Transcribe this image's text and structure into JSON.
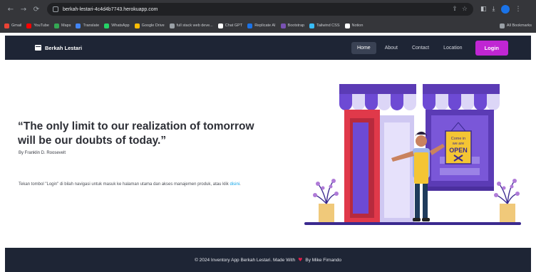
{
  "browser": {
    "url": "berkah-lestari-4c4d4b7743.herokuapp.com",
    "bookmarks": [
      {
        "label": "Gmail",
        "color": "#ea4335"
      },
      {
        "label": "YouTube",
        "color": "#ff0000"
      },
      {
        "label": "Maps",
        "color": "#34a853"
      },
      {
        "label": "Translate",
        "color": "#4285f4"
      },
      {
        "label": "WhatsApp",
        "color": "#25d366"
      },
      {
        "label": "Google Drive",
        "color": "#fbbc04"
      },
      {
        "label": "full stack web deve...",
        "color": "#9aa0a6"
      },
      {
        "label": "Chat GPT",
        "color": "#ffffff"
      },
      {
        "label": "Replicate AI",
        "color": "#1a73e8"
      },
      {
        "label": "Bootstrap",
        "color": "#7952b3"
      },
      {
        "label": "Tailwind CSS",
        "color": "#38bdf8"
      },
      {
        "label": "Notion",
        "color": "#ffffff"
      }
    ],
    "bookmarks_right": "All Bookmarks"
  },
  "navbar": {
    "brand": "Berkah Lestari",
    "links": [
      "Home",
      "About",
      "Contact",
      "Location"
    ],
    "login": "Login"
  },
  "hero": {
    "quote": "“The only limit to our realization of tomorrow will be our doubts of today.”",
    "author": "By Franklin D. Roosevelt",
    "instruction_text": "Tekan tombol \"Login\" di bilah navigasi untuk masuk ke halaman utama dan akses manajemen produk, atau klik ",
    "instruction_link": "disini",
    "instruction_end": ".",
    "sign": {
      "line1": "Come in",
      "line2": "we are",
      "line3": "OPEN"
    }
  },
  "footer": {
    "text_before": "© 2024 Inventory App Berkah Lestari. Made With",
    "text_after": "By Mike Firnando"
  },
  "colors": {
    "navbar": "#1e2535",
    "accent": "#c026d3",
    "link": "#0ea5e9",
    "awning": "#6d4ad4",
    "door": "#e0394a"
  },
  "icons": {
    "brand": "store-icon",
    "footer": "heart-icon"
  }
}
